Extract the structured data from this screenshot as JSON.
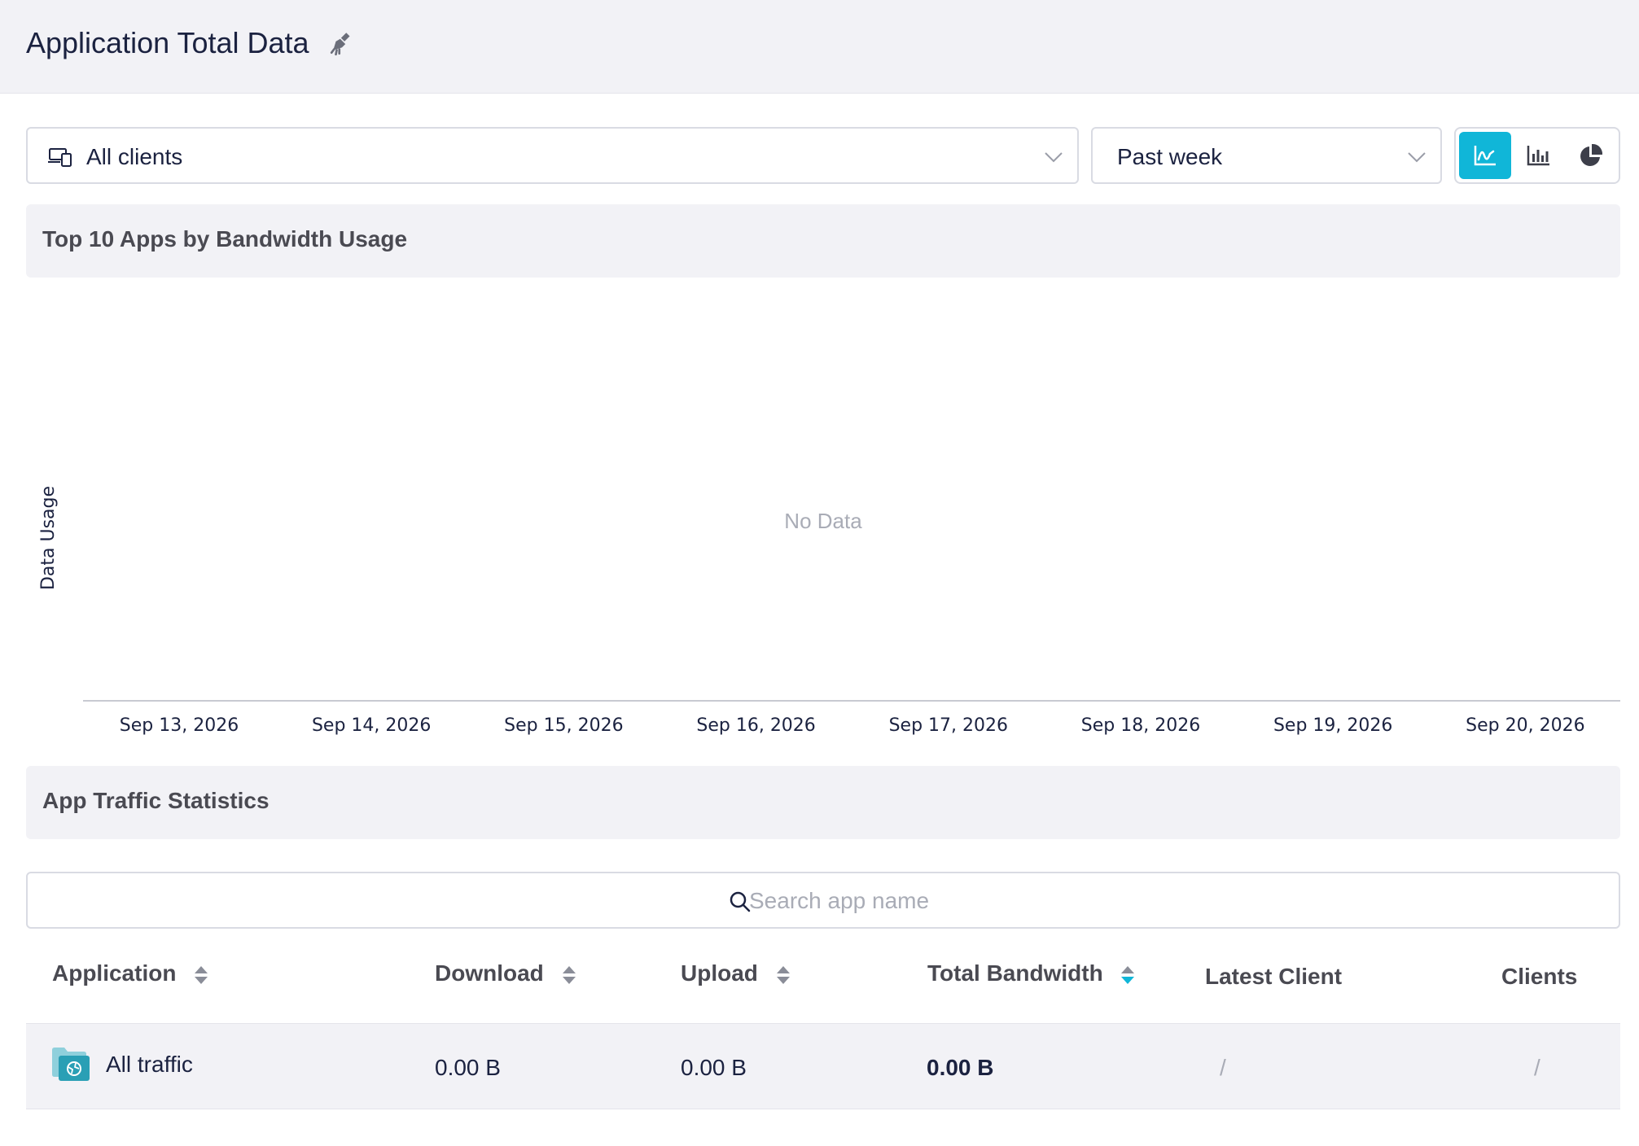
{
  "header": {
    "title": "Application Total Data",
    "icon": "broom-icon"
  },
  "filters": {
    "client_select": {
      "value": "All clients",
      "icon": "devices-icon"
    },
    "period_select": {
      "value": "Past week"
    },
    "view_modes": [
      "line-chart-icon",
      "bar-chart-icon",
      "pie-chart-icon"
    ],
    "active_view": "line"
  },
  "chart_section": {
    "title": "Top 10 Apps by Bandwidth Usage"
  },
  "chart_data": {
    "type": "line",
    "title": "Top 10 Apps by Bandwidth Usage",
    "ylabel": "Data Usage",
    "xlabel": "",
    "categories": [
      "Sep 13, 2026",
      "Sep 14, 2026",
      "Sep 15, 2026",
      "Sep 16, 2026",
      "Sep 17, 2026",
      "Sep 18, 2026",
      "Sep 19, 2026",
      "Sep 20, 2026"
    ],
    "series": [],
    "empty_message": "No Data",
    "grid": false
  },
  "stats_section": {
    "title": "App Traffic Statistics"
  },
  "search": {
    "placeholder": "Search app name",
    "value": ""
  },
  "table": {
    "columns": {
      "application": "Application",
      "download": "Download",
      "upload": "Upload",
      "total": "Total Bandwidth",
      "latest_client": "Latest Client",
      "clients": "Clients"
    },
    "rows": [
      {
        "application": "All traffic",
        "download": "0.00 B",
        "upload": "0.00 B",
        "total": "0.00 B",
        "latest_client": "/",
        "clients": "/"
      }
    ]
  },
  "colors": {
    "accent": "#10b6d8",
    "header_bg": "#f2f2f6",
    "text": "#1b2240",
    "muted": "#a9acb6"
  }
}
